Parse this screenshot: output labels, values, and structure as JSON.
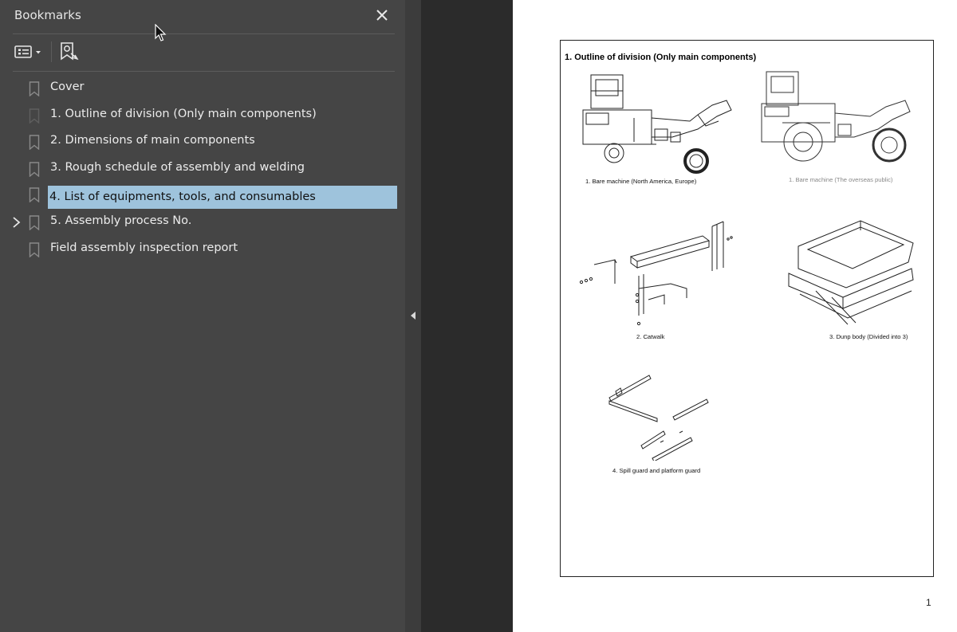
{
  "panel": {
    "title": "Bookmarks",
    "items": [
      {
        "label": "Cover",
        "selected": false,
        "expandable": false
      },
      {
        "label": "1. Outline of division (Only main components)",
        "selected": false,
        "expandable": false
      },
      {
        "label": "2. Dimensions of main components",
        "selected": false,
        "expandable": false
      },
      {
        "label": "3. Rough schedule of assembly and welding",
        "selected": false,
        "expandable": false
      },
      {
        "label": "4. List of equipments, tools, and consumables",
        "selected": true,
        "expandable": false
      },
      {
        "label": "5. Assembly process No.",
        "selected": false,
        "expandable": true
      },
      {
        "label": "Field assembly inspection report",
        "selected": false,
        "expandable": false
      }
    ],
    "icons": {
      "close": "close-icon",
      "options": "bookmark-options-icon",
      "find": "find-current-bookmark-icon",
      "bookmark": "bookmark-icon",
      "expand": "chevron-right-icon",
      "collapse": "collapse-panel-icon"
    }
  },
  "document": {
    "heading": "1.  Outline of division (Only main components)",
    "captions": {
      "c1": "1. Bare machine (North America, Europe)",
      "c2": "1. Bare machine (The overseas public)",
      "c3": "2.  Catwalk",
      "c4": "3. Dunp body (Divided into 3)",
      "c5": "4. Spill guard and platform guard"
    },
    "page_number": "1"
  },
  "colors": {
    "panel_bg": "#454545",
    "selection": "#9ec3dc",
    "canvas_bg": "#2b2b2b",
    "page_bg": "#ffffff"
  }
}
